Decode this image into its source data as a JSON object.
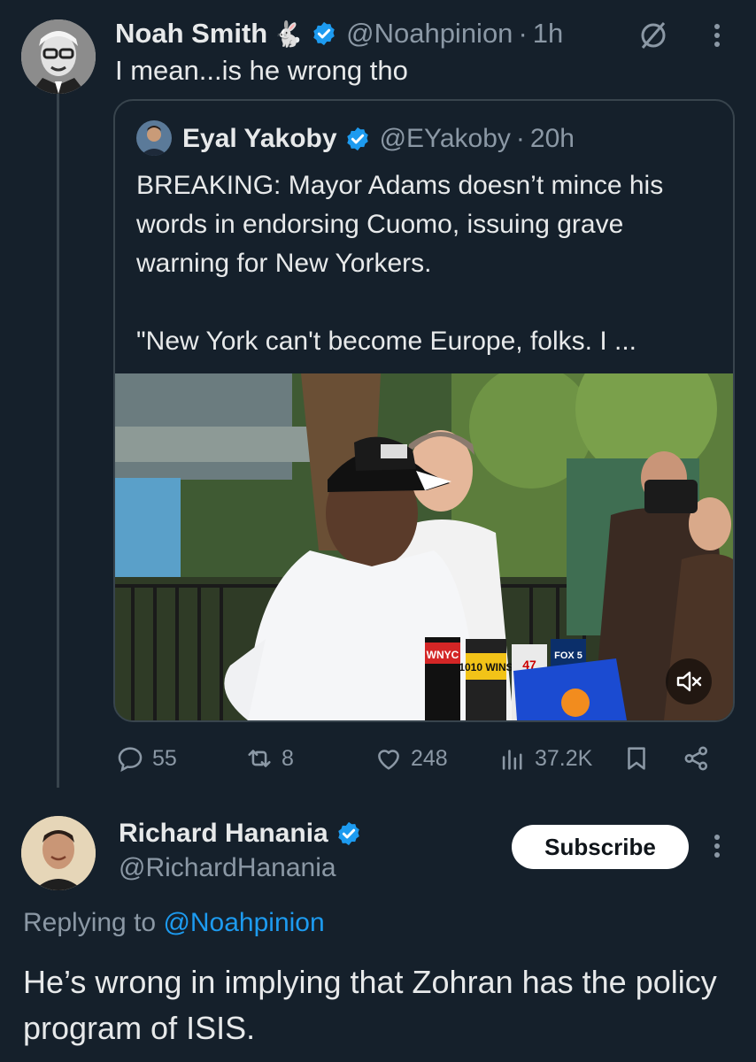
{
  "colors": {
    "background": "#15202b",
    "text_primary": "#e7e9ea",
    "text_secondary": "#8b98a5",
    "accent_link": "#1d9bf0",
    "verified_badge": "#1d9bf0",
    "border": "#38444d"
  },
  "main_tweet": {
    "author_name": "Noah Smith",
    "author_emoji": "🐇",
    "handle": "@Noahpinion",
    "separator": "·",
    "time": "1h",
    "text": "I mean...is he wrong tho",
    "icons": [
      "verified-badge-icon",
      "grok-icon",
      "more-icon"
    ]
  },
  "quoted_tweet": {
    "author_name": "Eyal Yakoby",
    "handle": "@EYakoby",
    "separator": "·",
    "time": "20h",
    "text_para1": "BREAKING: Mayor Adams doesn’t mince his words in endorsing Cuomo, issuing grave warning for New Yorkers.",
    "text_para2": "\"New York can't become Europe, folks. I ...",
    "media": {
      "kind": "video",
      "mic_labels": [
        "WNYC",
        "1010 WINS",
        "47",
        "FOX 5"
      ],
      "icons": [
        "mute-icon"
      ]
    }
  },
  "actions": {
    "replies": "55",
    "reposts": "8",
    "likes": "248",
    "views": "37.2K",
    "icons": [
      "reply-icon",
      "repost-icon",
      "like-icon",
      "views-icon",
      "bookmark-icon",
      "share-icon"
    ]
  },
  "reply_tweet": {
    "author_name": "Richard Hanania",
    "handle": "@RichardHanania",
    "subscribe_label": "Subscribe",
    "replying_prefix": "Replying to ",
    "replying_mention": "@Noahpinion",
    "text": "He’s wrong in implying that Zohran has the policy program of ISIS.",
    "icons": [
      "verified-badge-icon",
      "more-icon"
    ]
  }
}
